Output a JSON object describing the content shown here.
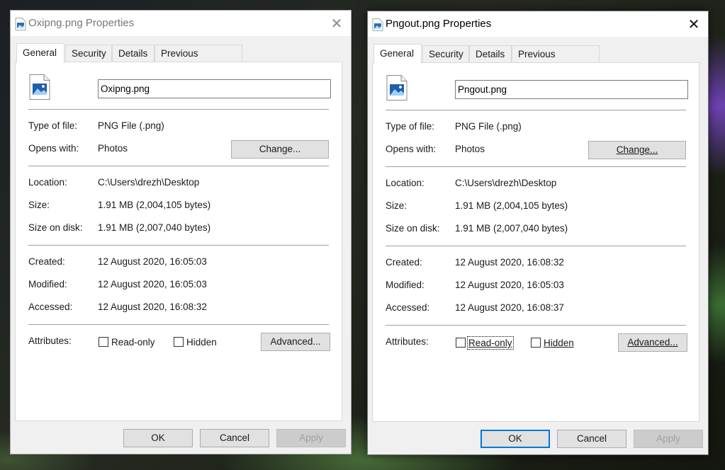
{
  "dialogs": [
    {
      "title": "Oxipng.png Properties",
      "tabs": [
        "General",
        "Security",
        "Details",
        "Previous Versions"
      ],
      "file_name": "Oxipng.png",
      "type_label": "Type of file:",
      "type_value": "PNG File (.png)",
      "opens_label": "Opens with:",
      "opens_value": "Photos",
      "change_label": "Change...",
      "location_label": "Location:",
      "location_value": "C:\\Users\\drezh\\Desktop",
      "size_label": "Size:",
      "size_value": "1.91 MB (2,004,105 bytes)",
      "disk_label": "Size on disk:",
      "disk_value": "1.91 MB (2,007,040 bytes)",
      "created_label": "Created:",
      "created_value": "12 August 2020, 16:05:03",
      "modified_label": "Modified:",
      "modified_value": "12 August 2020, 16:05:03",
      "accessed_label": "Accessed:",
      "accessed_value": "12 August 2020, 16:08:32",
      "attributes_label": "Attributes:",
      "readonly_label": "Read-only",
      "hidden_label": "Hidden",
      "advanced_label": "Advanced...",
      "ok_label": "OK",
      "cancel_label": "Cancel",
      "apply_label": "Apply",
      "close_glyph": "✕"
    },
    {
      "title": "Pngout.png Properties",
      "tabs": [
        "General",
        "Security",
        "Details",
        "Previous Versions"
      ],
      "file_name": "Pngout.png",
      "type_label": "Type of file:",
      "type_value": "PNG File (.png)",
      "opens_label": "Opens with:",
      "opens_value": "Photos",
      "change_label": "Change...",
      "location_label": "Location:",
      "location_value": "C:\\Users\\drezh\\Desktop",
      "size_label": "Size:",
      "size_value": "1.91 MB (2,004,105 bytes)",
      "disk_label": "Size on disk:",
      "disk_value": "1.91 MB (2,007,040 bytes)",
      "created_label": "Created:",
      "created_value": "12 August 2020, 16:08:32",
      "modified_label": "Modified:",
      "modified_value": "12 August 2020, 16:05:03",
      "accessed_label": "Accessed:",
      "accessed_value": "12 August 2020, 16:08:37",
      "attributes_label": "Attributes:",
      "readonly_label": "Read-only",
      "hidden_label": "Hidden",
      "advanced_label": "Advanced...",
      "ok_label": "OK",
      "cancel_label": "Cancel",
      "apply_label": "Apply",
      "close_glyph": "✕"
    }
  ],
  "icons": {
    "file": "png-image-file-icon",
    "close": "close-icon"
  },
  "colors": {
    "accent": "#0078d7",
    "dialog_bg": "#f0f0f0",
    "panel_bg": "#ffffff"
  }
}
